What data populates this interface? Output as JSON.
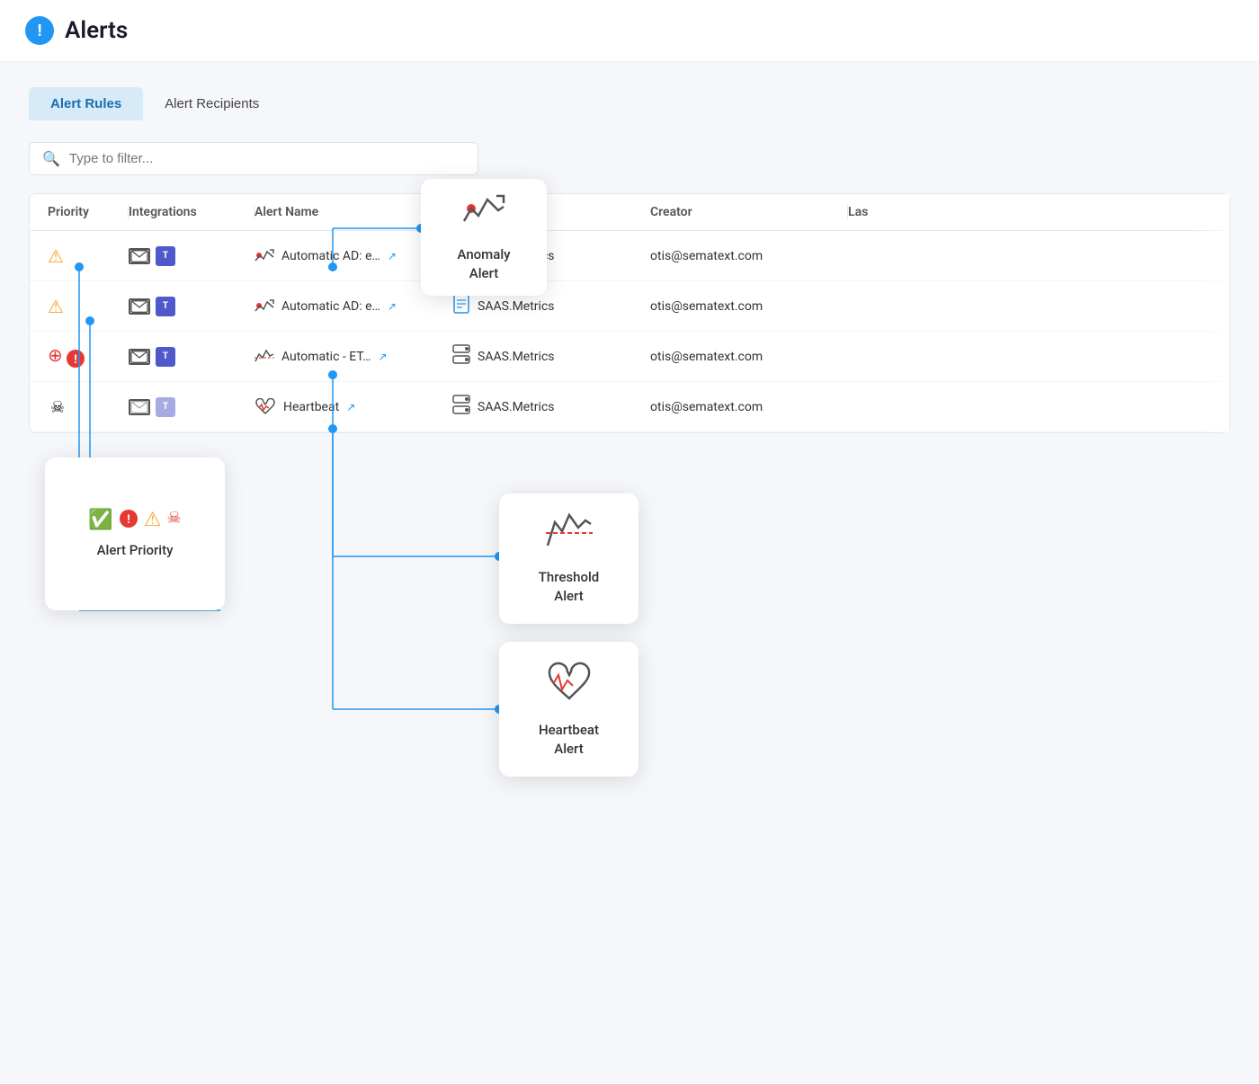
{
  "header": {
    "icon_label": "!",
    "title": "Alerts"
  },
  "tabs": [
    {
      "id": "alert-rules",
      "label": "Alert Rules",
      "active": true
    },
    {
      "id": "alert-recipients",
      "label": "Alert Recipients",
      "active": false
    }
  ],
  "search": {
    "placeholder": "Type to filter..."
  },
  "table": {
    "columns": [
      {
        "id": "priority",
        "label": "Priority"
      },
      {
        "id": "integrations",
        "label": "Integrations"
      },
      {
        "id": "alert_name",
        "label": "Alert Name"
      },
      {
        "id": "app",
        "label": ""
      },
      {
        "id": "creator",
        "label": "Creator"
      },
      {
        "id": "last",
        "label": "Las"
      }
    ],
    "rows": [
      {
        "priority": "warning",
        "priority_icon": "⚠️",
        "integration_email": true,
        "integration_teams": true,
        "alert_type": "anomaly",
        "alert_name": "Automatic AD: e…",
        "app_name": "SAAS.Metrics",
        "app_type": "doc",
        "creator": "otis@sematext.com"
      },
      {
        "priority": "warning",
        "priority_icon": "⚠️",
        "integration_email": true,
        "integration_teams": true,
        "alert_type": "anomaly",
        "alert_name": "Automatic AD: e…",
        "app_name": "SAAS.Metrics",
        "app_type": "doc",
        "creator": "otis@sematext.com"
      },
      {
        "priority": "critical",
        "priority_icon": "🔴",
        "integration_email": true,
        "integration_teams": true,
        "alert_type": "threshold",
        "alert_name": "Automatic - ET…",
        "app_name": "SAAS.Metrics",
        "app_type": "server",
        "creator": "otis@sematext.com"
      },
      {
        "priority": "skull",
        "priority_icon": "☠️",
        "integration_email": true,
        "integration_teams": true,
        "alert_type": "heartbeat",
        "alert_name": "Heartbeat",
        "app_name": "SAAS.Metrics",
        "app_type": "server",
        "creator": "otis@sematext.com"
      }
    ]
  },
  "popups": {
    "anomaly": {
      "label": "Anomaly\nAlert"
    },
    "alert_priority": {
      "label": "Alert Priority"
    },
    "threshold": {
      "label": "Threshold\nAlert"
    },
    "heartbeat": {
      "label": "Heartbeat\nAlert"
    }
  }
}
